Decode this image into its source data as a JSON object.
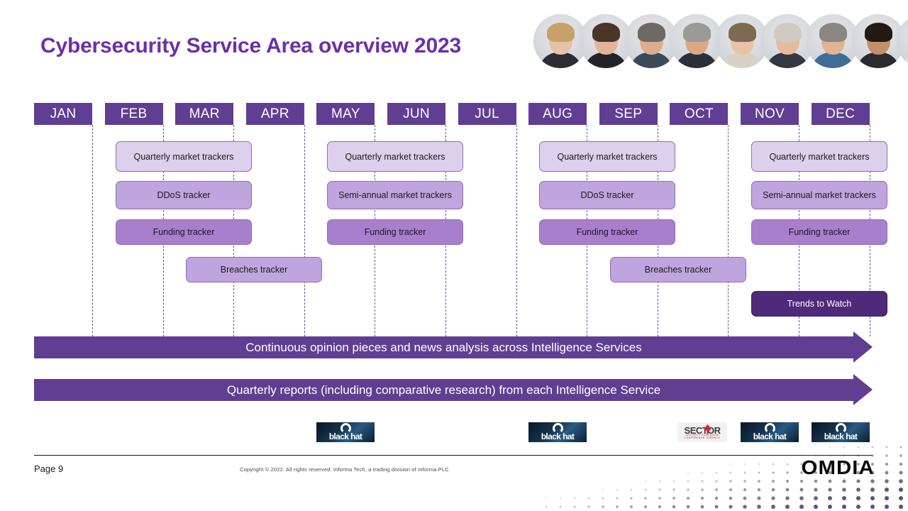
{
  "slide": {
    "title": "Cybersecurity Service Area overview 2023",
    "page_label": "Page 9",
    "copyright": "Copyright © 2022. All rights reserved. Informa Tech, a trading division of Informa PLC",
    "brand_logo": "OMDIA",
    "accent_color": "#6b2fab",
    "header_bar_color": "#603e92",
    "gridline_color": "#7a4fb0"
  },
  "avatars": {
    "count": 10,
    "items": [
      {
        "name": "headshot-1",
        "skin": "#e7c2a8",
        "hair": "#c8a06a",
        "clothes": "#2c2c34"
      },
      {
        "name": "headshot-2",
        "skin": "#e3b497",
        "hair": "#4a3528",
        "clothes": "#23242a"
      },
      {
        "name": "headshot-3",
        "skin": "#dcae8c",
        "hair": "#6d6a64",
        "clothes": "#3a4a58"
      },
      {
        "name": "headshot-4",
        "skin": "#dba883",
        "hair": "#9a9a96",
        "clothes": "#2b2f3a"
      },
      {
        "name": "headshot-5",
        "skin": "#e8c3a6",
        "hair": "#7e6a52",
        "clothes": "#d9d2c4"
      },
      {
        "name": "headshot-6",
        "skin": "#e5bb9c",
        "hair": "#cfcac2",
        "clothes": "#33373f"
      },
      {
        "name": "headshot-7",
        "skin": "#e0b492",
        "hair": "#8a8782",
        "clothes": "#3f6d96"
      },
      {
        "name": "headshot-8",
        "skin": "#c28f68",
        "hair": "#231a16",
        "clothes": "#2a2a30"
      },
      {
        "name": "headshot-9",
        "skin": "#e9c6a9",
        "hair": "#d8b878",
        "clothes": "#e2e2e2"
      },
      {
        "name": "headshot-10",
        "skin": "#d8a880",
        "hair": "#3a2a20",
        "clothes": "#2d2d33"
      }
    ]
  },
  "chart_data": {
    "type": "table",
    "title": "Cybersecurity Service Area overview 2023",
    "months": [
      "JAN",
      "FEB",
      "MAR",
      "APR",
      "MAY",
      "JUN",
      "JUL",
      "AUG",
      "SEP",
      "OCT",
      "NOV",
      "DEC"
    ],
    "tracker_items": [
      {
        "label": "Quarterly market trackers",
        "tone": "tone-light",
        "start_month": "FEB",
        "span_months": 2,
        "row": 1
      },
      {
        "label": "DDoS tracker",
        "tone": "tone-mid",
        "start_month": "FEB",
        "span_months": 2,
        "row": 2
      },
      {
        "label": "Funding tracker",
        "tone": "tone-strong",
        "start_month": "FEB",
        "span_months": 2,
        "row": 3
      },
      {
        "label": "Breaches tracker",
        "tone": "tone-mid",
        "start_month": "MAR",
        "span_months": 2,
        "row": 4
      },
      {
        "label": "Quarterly market trackers",
        "tone": "tone-light",
        "start_month": "MAY",
        "span_months": 2,
        "row": 1
      },
      {
        "label": "Semi-annual market trackers",
        "tone": "tone-mid",
        "start_month": "MAY",
        "span_months": 2,
        "row": 2
      },
      {
        "label": "Funding tracker",
        "tone": "tone-strong",
        "start_month": "MAY",
        "span_months": 2,
        "row": 3
      },
      {
        "label": "Quarterly market trackers",
        "tone": "tone-light",
        "start_month": "AUG",
        "span_months": 2,
        "row": 1
      },
      {
        "label": "DDoS tracker",
        "tone": "tone-mid",
        "start_month": "AUG",
        "span_months": 2,
        "row": 2
      },
      {
        "label": "Funding tracker",
        "tone": "tone-strong",
        "start_month": "AUG",
        "span_months": 2,
        "row": 3
      },
      {
        "label": "Breaches tracker",
        "tone": "tone-mid",
        "start_month": "SEP",
        "span_months": 2,
        "row": 4
      },
      {
        "label": "Quarterly market trackers",
        "tone": "tone-light",
        "start_month": "NOV",
        "span_months": 2,
        "row": 1
      },
      {
        "label": "Semi-annual market trackers",
        "tone": "tone-mid",
        "start_month": "NOV",
        "span_months": 2,
        "row": 2
      },
      {
        "label": "Funding tracker",
        "tone": "tone-strong",
        "start_month": "NOV",
        "span_months": 2,
        "row": 3
      },
      {
        "label": "Trends to Watch",
        "tone": "tone-dark",
        "start_month": "NOV",
        "span_months": 2,
        "row": 5
      }
    ],
    "banners": [
      {
        "label": "Continuous opinion pieces and news analysis across Intelligence Services"
      },
      {
        "label": "Quarterly reports (including comparative research) from each Intelligence Service"
      }
    ],
    "event_logos": [
      {
        "kind": "blackhat",
        "label": "black hat",
        "month_hint": "MAY"
      },
      {
        "kind": "blackhat",
        "label": "black hat",
        "month_hint": "AUG"
      },
      {
        "kind": "sector",
        "label": "SECTOR",
        "sub": "SECURITY EDUCATION CONFERENCE TORONTO",
        "month_hint": "OCT"
      },
      {
        "kind": "blackhat",
        "label": "black hat",
        "month_hint": "NOV"
      },
      {
        "kind": "blackhat",
        "label": "black hat",
        "month_hint": "DEC"
      }
    ]
  }
}
